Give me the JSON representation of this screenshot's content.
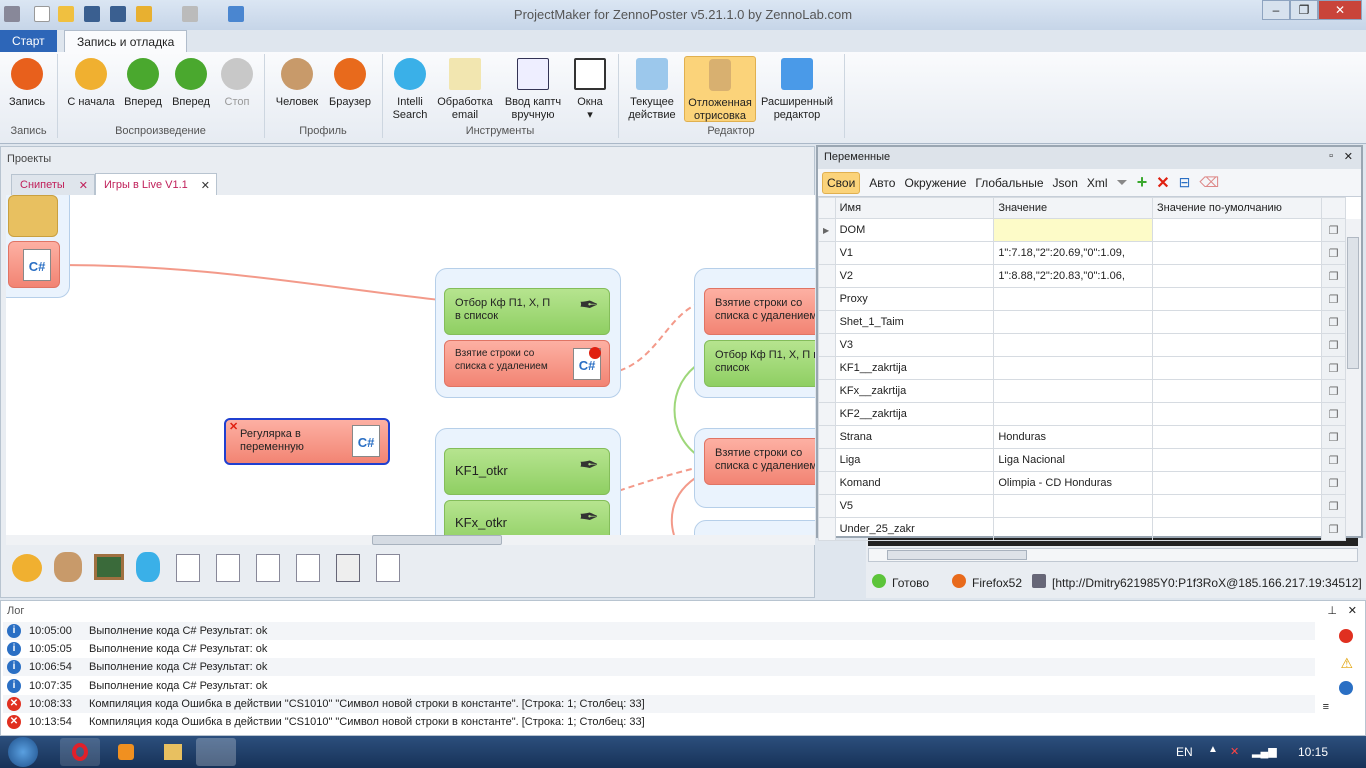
{
  "window": {
    "title": "ProjectMaker for ZennoPoster v5.21.1.0 by ZennoLab.com"
  },
  "ribbon_tabs": [
    {
      "label": "Старт"
    },
    {
      "label": "Запись и отладка"
    }
  ],
  "ribbon": {
    "buttons": [
      {
        "label": "Запись",
        "icon": "record-icon"
      },
      {
        "label": "С начала",
        "icon": "restart-icon"
      },
      {
        "label": "Вперед",
        "icon": "play-icon"
      },
      {
        "label": "Вперед",
        "icon": "play-step-icon"
      },
      {
        "label": "Стоп",
        "icon": "stop-icon"
      },
      {
        "label": "Человек",
        "icon": "person-icon"
      },
      {
        "label": "Браузер",
        "icon": "firefox-icon"
      },
      {
        "label": "Intelli Search",
        "icon": "intelli-icon"
      },
      {
        "label": "Обработка email",
        "icon": "email-icon"
      },
      {
        "label": "Ввод каптч вручную",
        "icon": "captcha-icon"
      },
      {
        "label": "Окна",
        "icon": "windows-icon"
      },
      {
        "label": "Текущее действие",
        "icon": "current-action-icon"
      },
      {
        "label": "Отложенная отрисовка",
        "icon": "hourglass-icon"
      },
      {
        "label": "Расширенный редактор",
        "icon": "expand-icon"
      }
    ],
    "groups": [
      "Запись",
      "Воспроизведение",
      "Профиль",
      "Инструменты",
      "Редактор"
    ]
  },
  "projects": {
    "title": "Проекты",
    "tabs": [
      {
        "label": "Снипеты"
      },
      {
        "label": "Игры в Live V1.1"
      }
    ]
  },
  "canvas": {
    "nodes": {
      "n1": "Отбор Кф П1, X, П в список",
      "n2": "Взятие строки со списка с удалением",
      "n3": "KF1_otkr",
      "n4": "KFx_otkr",
      "n5": "Взятие строки со списка с удалением",
      "n6": "Отбор Кф П1, X, П в список",
      "n7": "Взятие строки со списка с удалением",
      "n8": "Регулярка в переменную"
    }
  },
  "variables": {
    "title": "Переменные",
    "tabs": [
      "Свои",
      "Авто",
      "Окружение",
      "Глобальные",
      "Json",
      "Xml"
    ],
    "columns": [
      "Имя",
      "Значение",
      "Значение по-умолчанию"
    ],
    "rows": [
      {
        "name": "DOM",
        "value": ""
      },
      {
        "name": "V1",
        "value": "1\":7.18,\"2\":20.69,\"0\":1.09,"
      },
      {
        "name": "V2",
        "value": "1\":8.88,\"2\":20.83,\"0\":1.06,"
      },
      {
        "name": "Proxy",
        "value": ""
      },
      {
        "name": "Shet_1_Taim",
        "value": ""
      },
      {
        "name": "V3",
        "value": ""
      },
      {
        "name": "KF1__zakrtija",
        "value": ""
      },
      {
        "name": "KFx__zakrtija",
        "value": ""
      },
      {
        "name": "KF2__zakrtija",
        "value": ""
      },
      {
        "name": "Strana",
        "value": "Honduras"
      },
      {
        "name": "Liga",
        "value": "Liga Nacional"
      },
      {
        "name": "Komand",
        "value": "Olimpia - CD Honduras"
      },
      {
        "name": "V5",
        "value": ""
      },
      {
        "name": "Under_25_zakr",
        "value": ""
      }
    ]
  },
  "status": {
    "state": "Готово",
    "browser": "Firefox52",
    "proxy": "[http://Dmitry621985Y0:P1f3RoX@185.166.217.19:34512]"
  },
  "log": {
    "title": "Лог",
    "entries": [
      {
        "type": "info",
        "time": "10:05:00",
        "text": "Выполнение кода C#  Результат: ok"
      },
      {
        "type": "info",
        "time": "10:05:05",
        "text": "Выполнение кода C#  Результат: ok"
      },
      {
        "type": "info",
        "time": "10:06:54",
        "text": "Выполнение кода C#  Результат: ok"
      },
      {
        "type": "info",
        "time": "10:07:35",
        "text": "Выполнение кода C#  Результат: ok"
      },
      {
        "type": "error",
        "time": "10:08:33",
        "text": "Компиляция кода  Ошибка в действии \"CS1010\" \"Символ новой строки в константе\". [Строка: 1; Столбец: 33]"
      },
      {
        "type": "error",
        "time": "10:13:54",
        "text": "Компиляция кода  Ошибка в действии \"CS1010\" \"Символ новой строки в константе\". [Строка: 1; Столбец: 33]"
      }
    ]
  },
  "taskbar": {
    "lang": "EN",
    "clock": "10:15"
  },
  "colors": {
    "accent": "#2b6cc4",
    "node_green": "#8fcf63",
    "node_red": "#f28473",
    "active_tab": "#fbd37a"
  }
}
